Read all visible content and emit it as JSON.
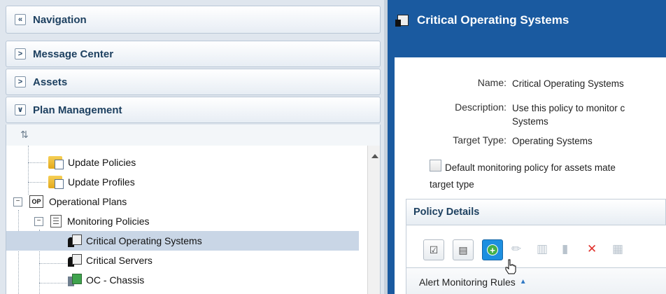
{
  "navigation": {
    "title": "Navigation",
    "collapse_glyph": "«",
    "sections": [
      {
        "label": "Message Center",
        "expanded": false,
        "glyph": ">"
      },
      {
        "label": "Assets",
        "expanded": false,
        "glyph": ">"
      },
      {
        "label": "Plan Management",
        "expanded": true,
        "glyph": "∨"
      }
    ],
    "refresh_icon": "refresh-icon",
    "tree": {
      "update_policies": "Update Policies",
      "update_profiles": "Update Profiles",
      "operational_plans": "Operational Plans",
      "operational_plans_icon_text": "OP",
      "monitoring_policies": "Monitoring Policies",
      "critical_os": "Critical Operating Systems",
      "critical_servers": "Critical Servers",
      "oc_chassis": "OC - Chassis",
      "expander_minus": "−"
    }
  },
  "detail": {
    "title": "Critical Operating Systems",
    "fields": {
      "name_label": "Name:",
      "name_value": "Critical Operating Systems",
      "description_label": "Description:",
      "description_value_line1": "Use this policy to monitor c",
      "description_value_line2": "Systems",
      "target_type_label": "Target Type:",
      "target_type_value": "Operating Systems"
    },
    "default_checkbox_text_line1": "Default monitoring policy for assets mate",
    "default_checkbox_text_line2": "target type",
    "default_checked": false,
    "policy_details": {
      "title": "Policy Details",
      "toolbar": {
        "select_all_icon": "checklist-icon",
        "details_icon": "details-icon",
        "add_icon": "add-icon",
        "add_glyph": "+",
        "edit_icon": "pencil-icon",
        "edit_glyph": "✏",
        "close_glyph": "✕"
      },
      "column_header": "Alert Monitoring Rules",
      "sort_glyph": "▲"
    }
  },
  "colors": {
    "header_blue": "#1a5aa0",
    "nav_bg": "#dfe6ee",
    "selection": "#c9d6e6",
    "active_button": "#1d8fe0"
  }
}
